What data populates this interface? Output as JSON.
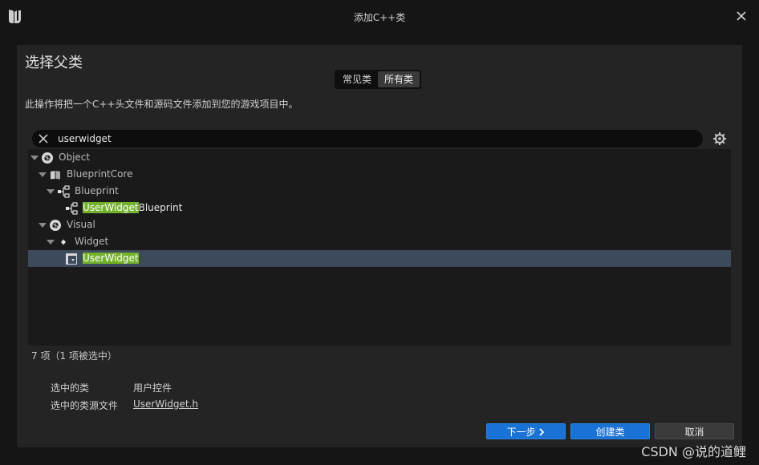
{
  "window": {
    "title": "添加C++类"
  },
  "header": {
    "heading": "选择父类"
  },
  "tabs": [
    {
      "label": "常见类",
      "active": false
    },
    {
      "label": "所有类",
      "active": true
    }
  ],
  "description": "此操作将把一个C++头文件和源码文件添加到您的游戏项目中。",
  "search": {
    "value": "userwidget",
    "placeholder": ""
  },
  "tree": {
    "rows": [
      {
        "name_pre": "",
        "name_hl": "",
        "name_post": "Object",
        "icon": "class-icon",
        "depth": 0,
        "expanded": true,
        "selected": false
      },
      {
        "name_pre": "",
        "name_hl": "",
        "name_post": "BlueprintCore",
        "icon": "book-icon",
        "depth": 1,
        "expanded": true,
        "selected": false
      },
      {
        "name_pre": "",
        "name_hl": "",
        "name_post": "Blueprint",
        "icon": "blueprint-icon",
        "depth": 2,
        "expanded": true,
        "selected": false
      },
      {
        "name_pre": "",
        "name_hl": "UserWidget",
        "name_post": "Blueprint",
        "icon": "blueprint-icon",
        "depth": 3,
        "expanded": null,
        "selected": false
      },
      {
        "name_pre": "",
        "name_hl": "",
        "name_post": "Visual",
        "icon": "class-icon",
        "depth": 1,
        "expanded": true,
        "selected": false
      },
      {
        "name_pre": "",
        "name_hl": "",
        "name_post": "Widget",
        "icon": "diamond-icon",
        "depth": 2,
        "expanded": true,
        "selected": false
      },
      {
        "name_pre": "",
        "name_hl": "UserWidget",
        "name_post": "",
        "icon": "user-widget-icon",
        "depth": 3,
        "expanded": null,
        "selected": true
      }
    ]
  },
  "status": {
    "count": "7 项（1 项被选中）"
  },
  "selection": {
    "class_label": "选中的类",
    "class_value": "用户控件",
    "file_label": "选中的类源文件",
    "file_value": "UserWidget.h"
  },
  "buttons": {
    "next": "下一步",
    "create": "创建类",
    "cancel": "取消"
  },
  "watermark": "CSDN @说的道鲤",
  "colors": {
    "accent": "#1a72d4",
    "highlight": "#74b12c",
    "selected_row": "#3d4a5c"
  }
}
